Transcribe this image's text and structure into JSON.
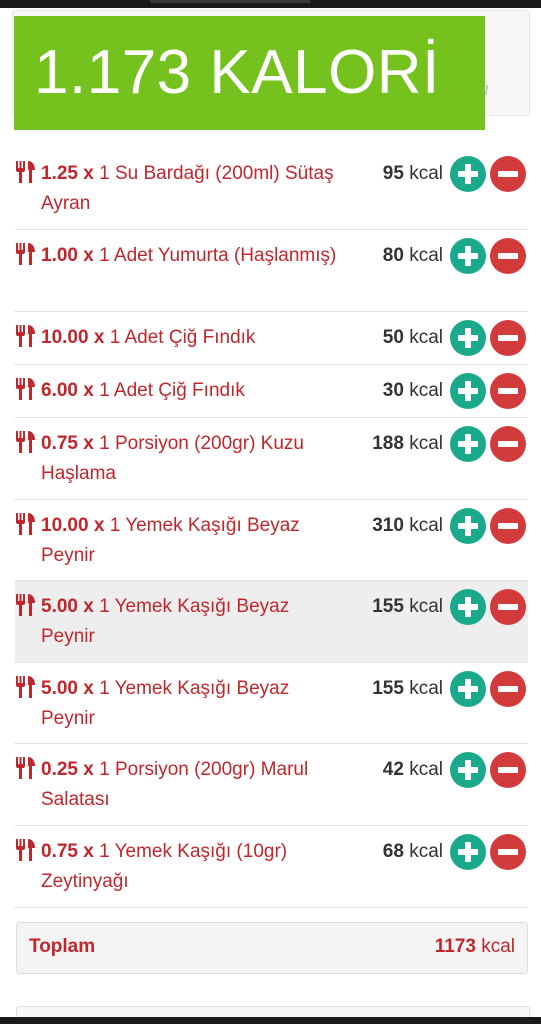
{
  "banner": {
    "calories_text": "1.173 KALORİ"
  },
  "background_card": {
    "partial_text_1": "r",
    "partial_text_2": "arı"
  },
  "items": [
    {
      "quantity": "1.25 x",
      "name": "1 Su Bardağı (200ml) Sütaş Ayran",
      "kcal_value": "95",
      "kcal_unit": "kcal"
    },
    {
      "quantity": "1.00 x",
      "name": "1 Adet Yumurta (Haşlanmış)",
      "kcal_value": "80",
      "kcal_unit": "kcal"
    },
    {
      "quantity": "10.00 x",
      "name": "1 Adet Çiğ Fındık",
      "kcal_value": "50",
      "kcal_unit": "kcal"
    },
    {
      "quantity": "6.00 x",
      "name": "1 Adet Çiğ Fındık",
      "kcal_value": "30",
      "kcal_unit": "kcal"
    },
    {
      "quantity": "0.75 x",
      "name": "1 Porsiyon (200gr) Kuzu Haşlama",
      "kcal_value": "188",
      "kcal_unit": "kcal"
    },
    {
      "quantity": "10.00 x",
      "name": "1 Yemek Kaşığı Beyaz Peynir",
      "kcal_value": "310",
      "kcal_unit": "kcal"
    },
    {
      "quantity": "5.00 x",
      "name": "1 Yemek Kaşığı Beyaz Peynir",
      "kcal_value": "155",
      "kcal_unit": "kcal"
    },
    {
      "quantity": "5.00 x",
      "name": "1 Yemek Kaşığı Beyaz Peynir",
      "kcal_value": "155",
      "kcal_unit": "kcal"
    },
    {
      "quantity": "0.25 x",
      "name": "1 Porsiyon (200gr) Marul Salatası",
      "kcal_value": "42",
      "kcal_unit": "kcal"
    },
    {
      "quantity": "0.75 x",
      "name": "1 Yemek Kaşığı (10gr) Zeytinyağı",
      "kcal_value": "68",
      "kcal_unit": "kcal"
    }
  ],
  "total": {
    "label": "Toplam",
    "value": "1173",
    "unit": "kcal"
  },
  "colors": {
    "banner_green": "#75c11d",
    "item_red": "#c0262c",
    "plus_teal": "#1aa98a",
    "minus_red": "#d33a3b"
  },
  "icons": {
    "item_icon": "fork-knife-icon",
    "increase_icon": "plus-circle-icon",
    "decrease_icon": "minus-circle-icon"
  }
}
